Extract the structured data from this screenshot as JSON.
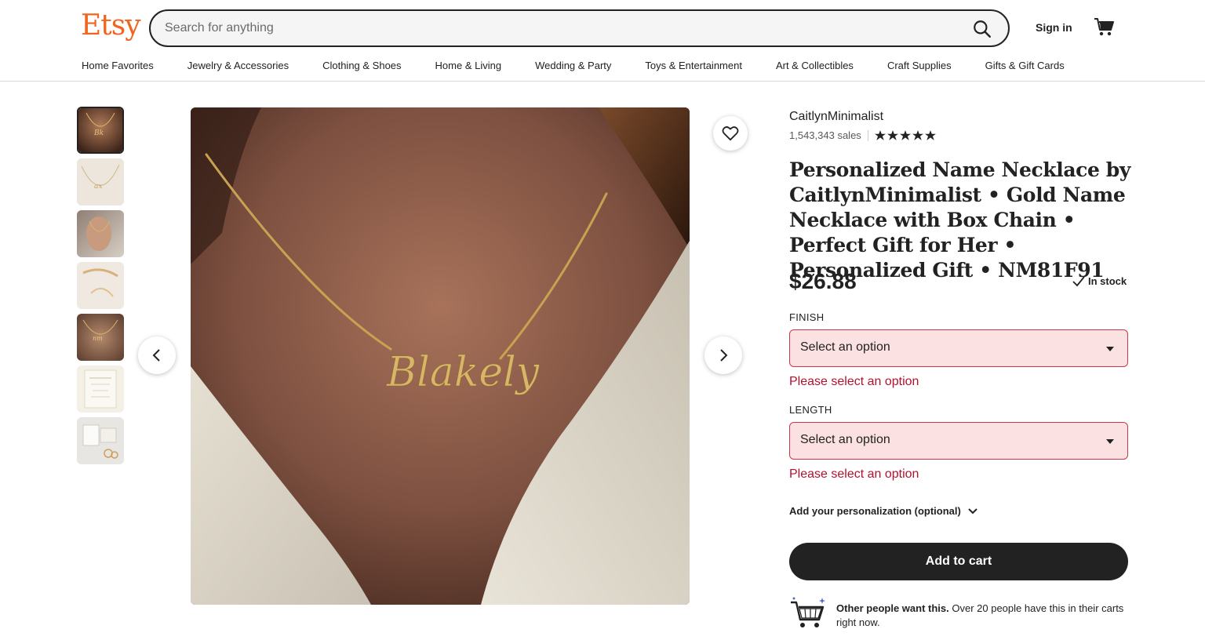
{
  "header": {
    "logo": "Etsy",
    "search_placeholder": "Search for anything",
    "sign_in": "Sign in"
  },
  "nav": [
    "Home Favorites",
    "Jewelry & Accessories",
    "Clothing & Shoes",
    "Home & Living",
    "Wedding & Party",
    "Toys & Entertainment",
    "Art & Collectibles",
    "Craft Supplies",
    "Gifts & Gift Cards"
  ],
  "product": {
    "shop_name": "CaitlynMinimalist",
    "sales": "1,543,343 sales",
    "rating_stars": 5,
    "title": "Personalized Name Necklace by CaitlynMinimalist • Gold Name Necklace with Box Chain • Perfect Gift for Her • Personalized Gift • NM81F91",
    "price": "$26.88",
    "stock": "In stock",
    "image_text": "Blakely",
    "thumbnail_count": 7
  },
  "options": {
    "finish": {
      "label": "FINISH",
      "value": "Select an option",
      "error": "Please select an option"
    },
    "length": {
      "label": "LENGTH",
      "value": "Select an option",
      "error": "Please select an option"
    }
  },
  "personalization": "Add your personalization (optional)",
  "add_to_cart": "Add to cart",
  "demand": {
    "bold": "Other people want this.",
    "text": " Over 20 people have this in their carts right now."
  },
  "colors": {
    "brand": "#f1641e",
    "error": "#b3112e",
    "error_bg": "#fbe1e1",
    "button": "#222222"
  }
}
